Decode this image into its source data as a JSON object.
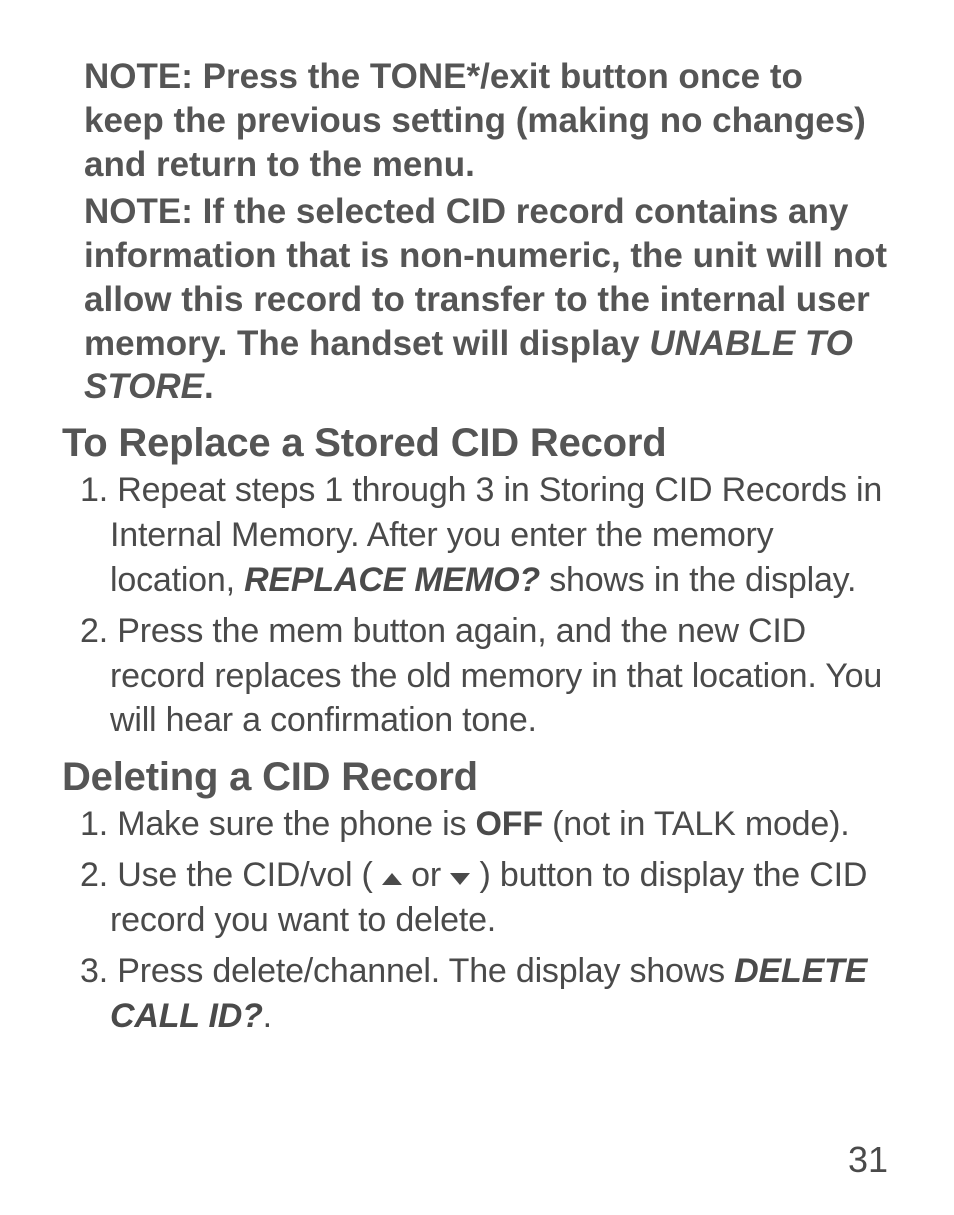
{
  "notes": {
    "note1": "NOTE: Press the TONE*/exit button once to keep the previous setting (making no changes) and return to the menu.",
    "note2_prefix": "NOTE: If the selected CID record contains any information that is non-numeric, the unit will not allow this record to transfer to the internal user memory. The handset will display ",
    "note2_code": "UNABLE TO STORE",
    "note2_suffix": "."
  },
  "section1": {
    "heading": "To Replace a Stored CID Record",
    "items": [
      {
        "pre": "Repeat steps 1 through 3 in Storing CID Records in Internal Memory. After you enter the memory location, ",
        "code": "REPLACE MEMO?",
        "post": " shows in the display."
      },
      {
        "text": "Press the mem button again, and the new CID record replaces the old memory in that location. You will hear a confirmation tone."
      }
    ]
  },
  "section2": {
    "heading": "Deleting a CID Record",
    "items": [
      {
        "pre": "Make sure the phone is ",
        "bold": "OFF",
        "post": " (not in TALK mode)."
      },
      {
        "pre": "Use the CID/vol ( ",
        "mid": " or ",
        "post": " ) button to display the CID record you want to delete."
      },
      {
        "pre": "Press delete/channel. The display shows ",
        "code": "DELETE CALL ID?",
        "post": "."
      }
    ]
  },
  "pageNumber": "31"
}
